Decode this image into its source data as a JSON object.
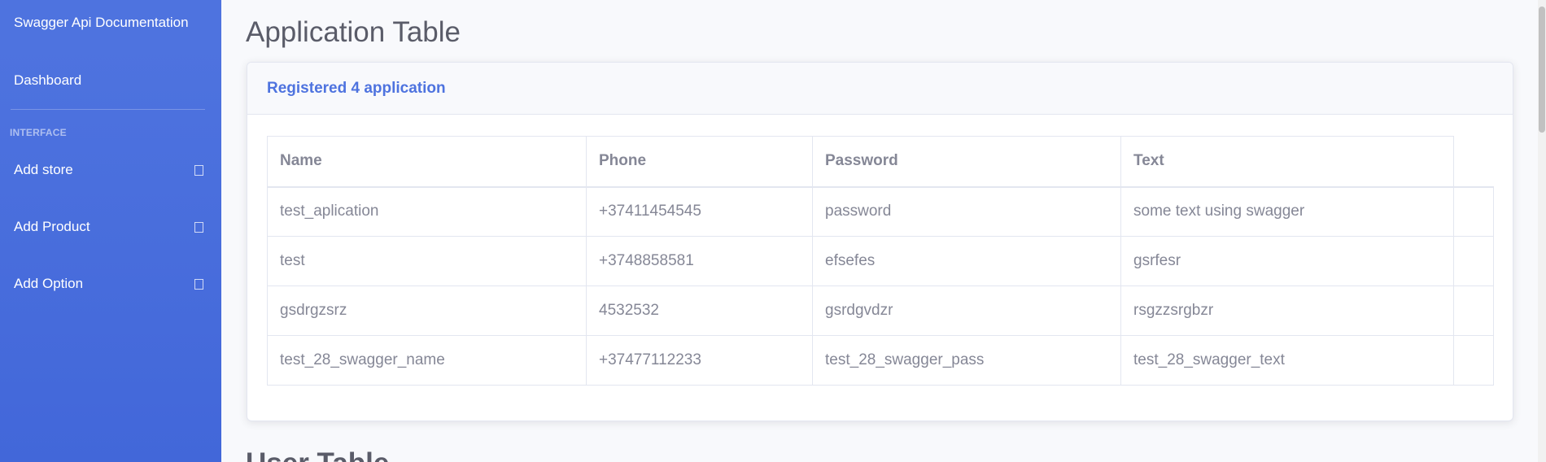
{
  "sidebar": {
    "brand": "Swagger Api Documentation",
    "dashboard": "Dashboard",
    "heading": "INTERFACE",
    "items": [
      {
        "label": "Add store",
        "icon": "collapse-icon"
      },
      {
        "label": "Add Product",
        "icon": "collapse-icon"
      },
      {
        "label": "Add Option",
        "icon": "collapse-icon"
      }
    ]
  },
  "main": {
    "title": "Application Table",
    "card_header": "Registered 4 application",
    "table": {
      "columns": [
        "Name",
        "Phone",
        "Password",
        "Text"
      ],
      "rows": [
        [
          "test_aplication",
          "+37411454545",
          "password",
          "some text using swagger"
        ],
        [
          "test",
          "+3748858581",
          "efsefes",
          "gsrfesr"
        ],
        [
          "gsdrgzsrz",
          "4532532",
          "gsrdgvdzr",
          "rsgzzsrgbzr"
        ],
        [
          "test_28_swagger_name",
          "+37477112233",
          "test_28_swagger_pass",
          "test_28_swagger_text"
        ]
      ]
    },
    "next_title": "User Table"
  },
  "colors": {
    "sidebar": "#4e73df",
    "accent": "#4e73df",
    "text": "#858796",
    "heading": "#5a5c69"
  }
}
